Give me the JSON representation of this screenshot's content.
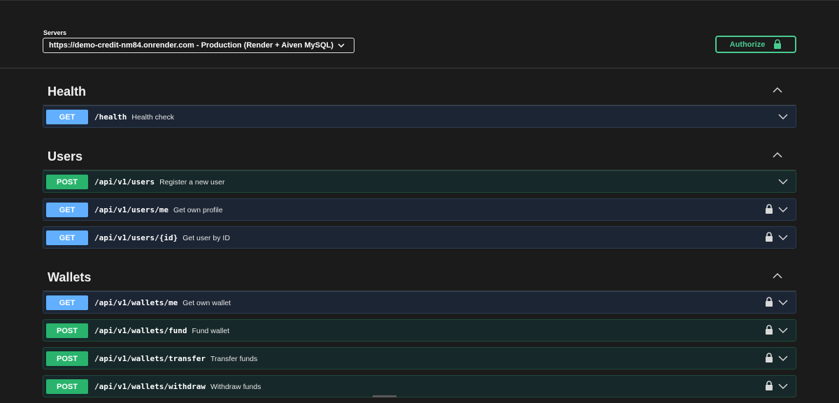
{
  "servers": {
    "label": "Servers",
    "selected": "https://demo-credit-nm84.onrender.com - Production (Render + Aiven MySQL)"
  },
  "authorize": {
    "label": "Authorize"
  },
  "colors": {
    "get": "#61affe",
    "post": "#29b36c",
    "authorize": "#49cc90"
  },
  "sections": [
    {
      "title": "Health",
      "ops": [
        {
          "method": "GET",
          "path": "/health",
          "summary": "Health check",
          "locked": false
        }
      ]
    },
    {
      "title": "Users",
      "ops": [
        {
          "method": "POST",
          "path": "/api/v1/users",
          "summary": "Register a new user",
          "locked": false
        },
        {
          "method": "GET",
          "path": "/api/v1/users/me",
          "summary": "Get own profile",
          "locked": true
        },
        {
          "method": "GET",
          "path": "/api/v1/users/{id}",
          "summary": "Get user by ID",
          "locked": true
        }
      ]
    },
    {
      "title": "Wallets",
      "ops": [
        {
          "method": "GET",
          "path": "/api/v1/wallets/me",
          "summary": "Get own wallet",
          "locked": true
        },
        {
          "method": "POST",
          "path": "/api/v1/wallets/fund",
          "summary": "Fund wallet",
          "locked": true
        },
        {
          "method": "POST",
          "path": "/api/v1/wallets/transfer",
          "summary": "Transfer funds",
          "locked": true
        },
        {
          "method": "POST",
          "path": "/api/v1/wallets/withdraw",
          "summary": "Withdraw funds",
          "locked": true
        }
      ]
    }
  ]
}
